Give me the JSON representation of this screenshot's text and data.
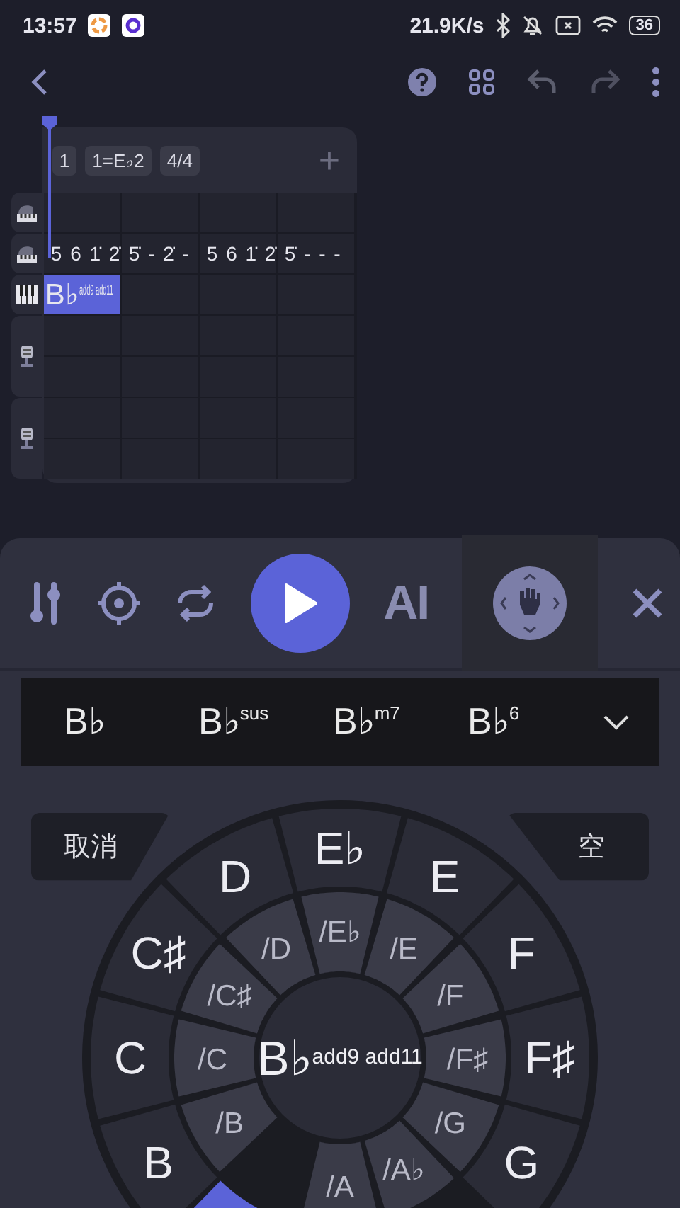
{
  "status_bar": {
    "time": "13:57",
    "net_speed": "21.9K/s",
    "battery": "36"
  },
  "toolbar": {
    "undo": {
      "disabled": true
    },
    "redo": {
      "disabled": true
    }
  },
  "timeline": {
    "bar_number": "1",
    "key": "1=E♭2",
    "time_signature": "4/4",
    "add": "+",
    "tracks": [
      {
        "kind": "piano"
      },
      {
        "kind": "piano",
        "notation": [
          "5 6 1̇ 2̇",
          "5̇ - 2̇ -",
          "5 6 1̇ 2̇",
          "5̇ - - -"
        ]
      },
      {
        "kind": "keyboard",
        "chord": {
          "root": "B♭",
          "suffix": "add9 add11",
          "selected": true
        }
      },
      {
        "kind": "vocal"
      },
      {
        "kind": "vocal"
      }
    ]
  },
  "panel": {
    "ai_label": "AI",
    "chord_options": [
      {
        "root": "B♭"
      },
      {
        "root": "B♭",
        "suffix": "sus"
      },
      {
        "root": "B♭",
        "suffix": "m7"
      },
      {
        "root": "B♭",
        "suffix": "6"
      }
    ],
    "cancel": "取消",
    "empty": "空",
    "center": {
      "root": "B♭",
      "suffix": "add9 add11"
    },
    "outer": [
      {
        "label": "E♭",
        "selected": false
      },
      {
        "label": "E",
        "selected": false
      },
      {
        "label": "F",
        "selected": false
      },
      {
        "label": "F♯",
        "selected": false
      },
      {
        "label": "G",
        "selected": false
      },
      {
        "kind": "hidden"
      },
      {
        "kind": "hidden"
      },
      {
        "selected": true
      },
      {
        "label": "B",
        "selected": false
      },
      {
        "label": "C",
        "selected": false
      },
      {
        "label": "C♯",
        "selected": false
      },
      {
        "label": "D",
        "selected": false
      }
    ],
    "inner": [
      {
        "kind": "slash",
        "label": "/E♭"
      },
      {
        "kind": "slash",
        "label": "/E"
      },
      {
        "kind": "slash",
        "label": "/F"
      },
      {
        "kind": "slash",
        "label": "/F♯"
      },
      {
        "kind": "slash",
        "label": "/G"
      },
      {
        "kind": "slash",
        "label": "/A♭"
      },
      {
        "kind": "slash",
        "label": "/A"
      },
      {
        "kind": "gap"
      },
      {
        "kind": "slash",
        "label": "/B"
      },
      {
        "kind": "slash",
        "label": "/C"
      },
      {
        "kind": "slash",
        "label": "/C♯"
      },
      {
        "kind": "slash",
        "label": "/D"
      }
    ]
  }
}
